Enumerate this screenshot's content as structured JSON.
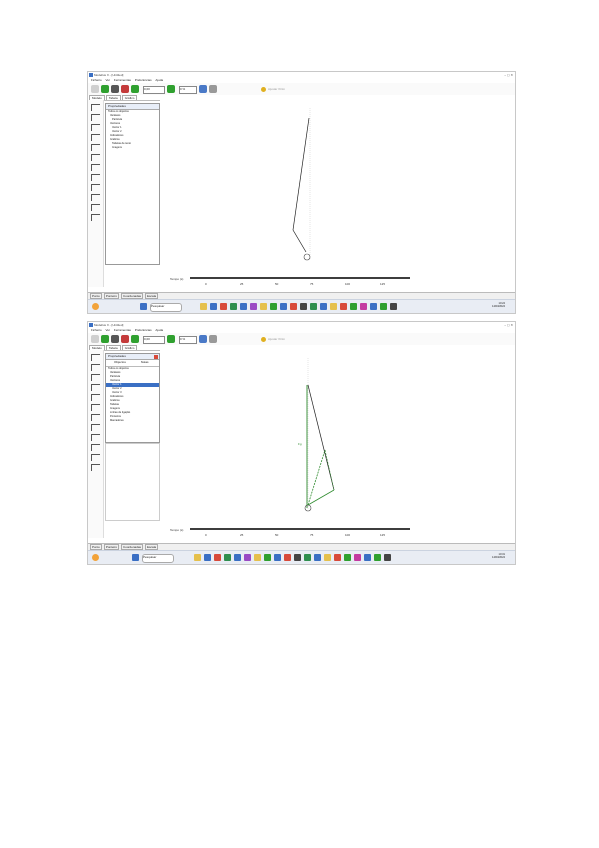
{
  "shots": [
    {
      "title": "Modellus X - [Untitled]",
      "menu": [
        "Ficheiro",
        "Ver",
        "Ferramentas",
        "Preferências",
        "Ajuda"
      ],
      "time_value": "0,00",
      "zoom_value": "0 %",
      "hint": "Ajustar Xtrim",
      "tabs": [
        "Modelo",
        "Tabela",
        "Gráfico"
      ],
      "panel_title": "Propriedades",
      "tree": [
        "Todos os objectos",
        "Variáveis",
        "Particula",
        "Vectores",
        "Vector 1",
        "Vector 2",
        "Indicadores",
        "Graficos",
        "Tabelas de texto",
        "Imagens"
      ],
      "axis_label": "Tempo (s)",
      "axis_ticks": [
        "0",
        "25",
        "50",
        "75",
        "100",
        "125"
      ],
      "status": [
        "Ponto",
        "Ponteiro",
        "Coordenadas",
        "Escala"
      ],
      "search_label": "Pesquisar",
      "clock_time": "10:24",
      "clock_date": "14/03/2024"
    },
    {
      "title": "Modellus X - [Untitled]",
      "menu": [
        "Ficheiro",
        "Ver",
        "Ferramentas",
        "Preferências",
        "Ajuda"
      ],
      "time_value": "0,00",
      "zoom_value": "0 %",
      "hint": "Ajustar Xtrim",
      "tabs": [
        "Modelo",
        "Tabela",
        "Gráfico"
      ],
      "panel_title": "Propriedades",
      "panel_tabs": [
        "Objectos",
        "Notas"
      ],
      "tree": [
        "Todos os objectos",
        "Variáveis",
        "Particula",
        "Vectores",
        "Vector 1",
        "Vector 2",
        "Vector 3",
        "Indicadores",
        "Graficos",
        "Tabelas",
        "Imagens",
        "Linhas de ligação",
        "Ponteiros",
        "Marcadores"
      ],
      "vector_label": "Fg",
      "axis_label": "Tempo (s)",
      "axis_ticks": [
        "0",
        "25",
        "50",
        "75",
        "100",
        "125"
      ],
      "status": [
        "Ponto",
        "Ponteiro",
        "Coordenadas",
        "Escala"
      ],
      "search_label": "Pesquisar",
      "clock_time": "10:31",
      "clock_date": "14/03/2024"
    }
  ],
  "colors": {
    "canvas_line": "#222222",
    "vector_green": "#2e8b2e",
    "accent": "#3a6fc4",
    "toolbar_green": "#2fa02f"
  }
}
